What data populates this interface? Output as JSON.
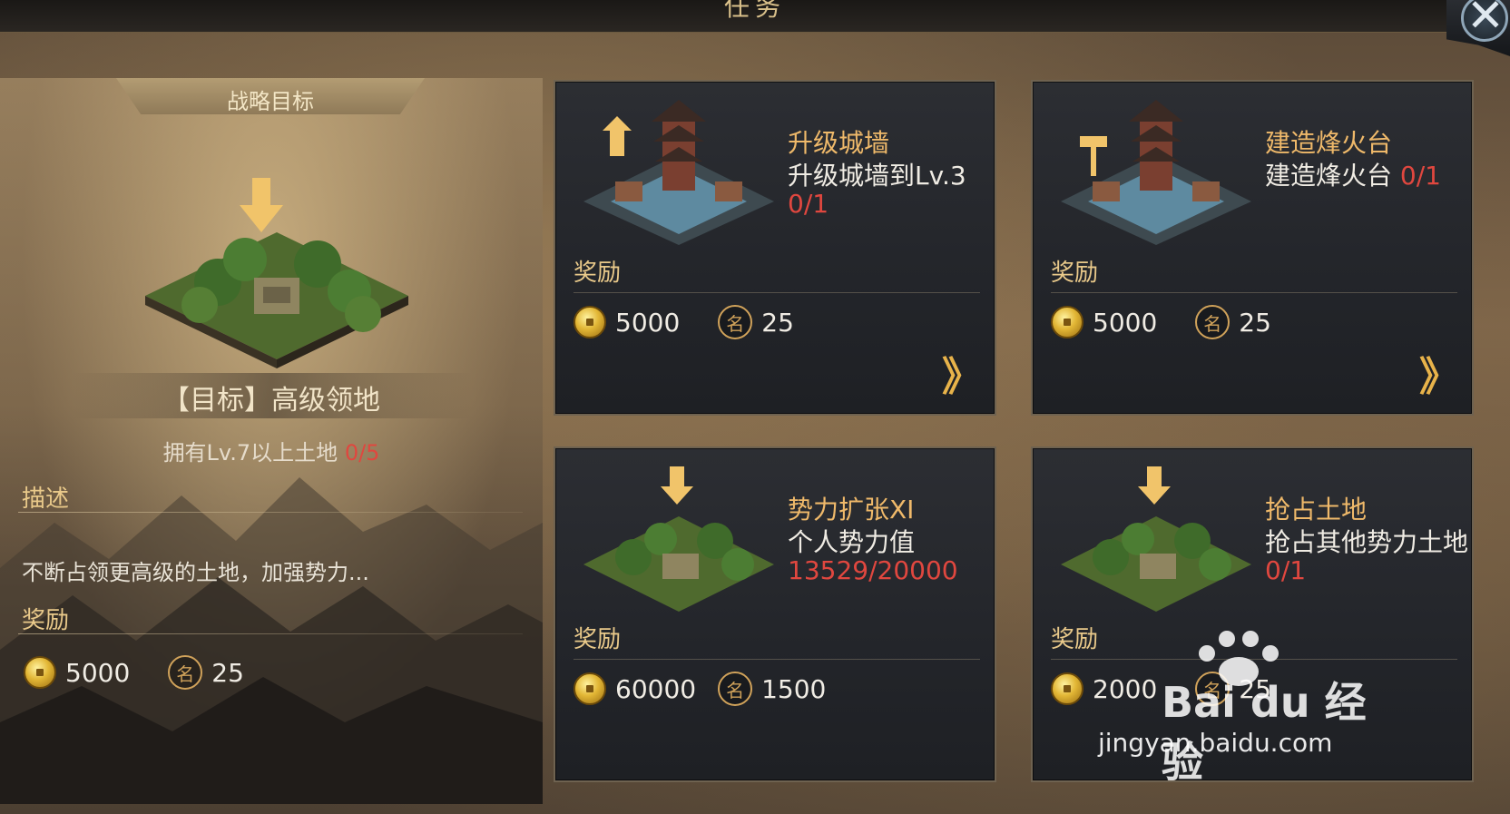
{
  "header": {
    "title": "任务"
  },
  "left": {
    "tab_label": "战略目标",
    "goal_name": "【目标】高级领地",
    "goal_condition_text": "拥有Lv.7以上土地",
    "goal_condition_progress": "0/5",
    "desc_label": "描述",
    "desc_text": "不断占领更高级的土地，加强势力...",
    "reward_label": "奖励",
    "rewards": {
      "coin": "5000",
      "fame": "25"
    }
  },
  "icons": {
    "coin": "coin-icon",
    "fame": "fame-icon",
    "fame_glyph": "名",
    "go": "double-chevron-right-icon",
    "close": "close-icon"
  },
  "cards": [
    {
      "title": "升级城墙",
      "subtitle": "升级城墙到Lv.3",
      "progress": "0/1",
      "reward_label": "奖励",
      "coin": "5000",
      "fame": "25",
      "go_glyph": "》"
    },
    {
      "title": "建造烽火台",
      "subtitle": "建造烽火台",
      "progress": "0/1",
      "reward_label": "奖励",
      "coin": "5000",
      "fame": "25",
      "go_glyph": "》"
    },
    {
      "title": "势力扩张XI",
      "subtitle": "个人势力值",
      "progress": "13529/20000",
      "reward_label": "奖励",
      "coin": "60000",
      "fame": "1500"
    },
    {
      "title": "抢占土地",
      "subtitle": "抢占其他势力土地",
      "progress": "0/1",
      "reward_label": "奖励",
      "coin": "2000",
      "fame": "25"
    }
  ],
  "watermark": {
    "brand": "Bai du 经验",
    "url": "jingyan.baidu.com"
  },
  "colors": {
    "accent_gold": "#efb96a",
    "progress_red": "#e0473f",
    "card_bg": "#2c2e33"
  }
}
